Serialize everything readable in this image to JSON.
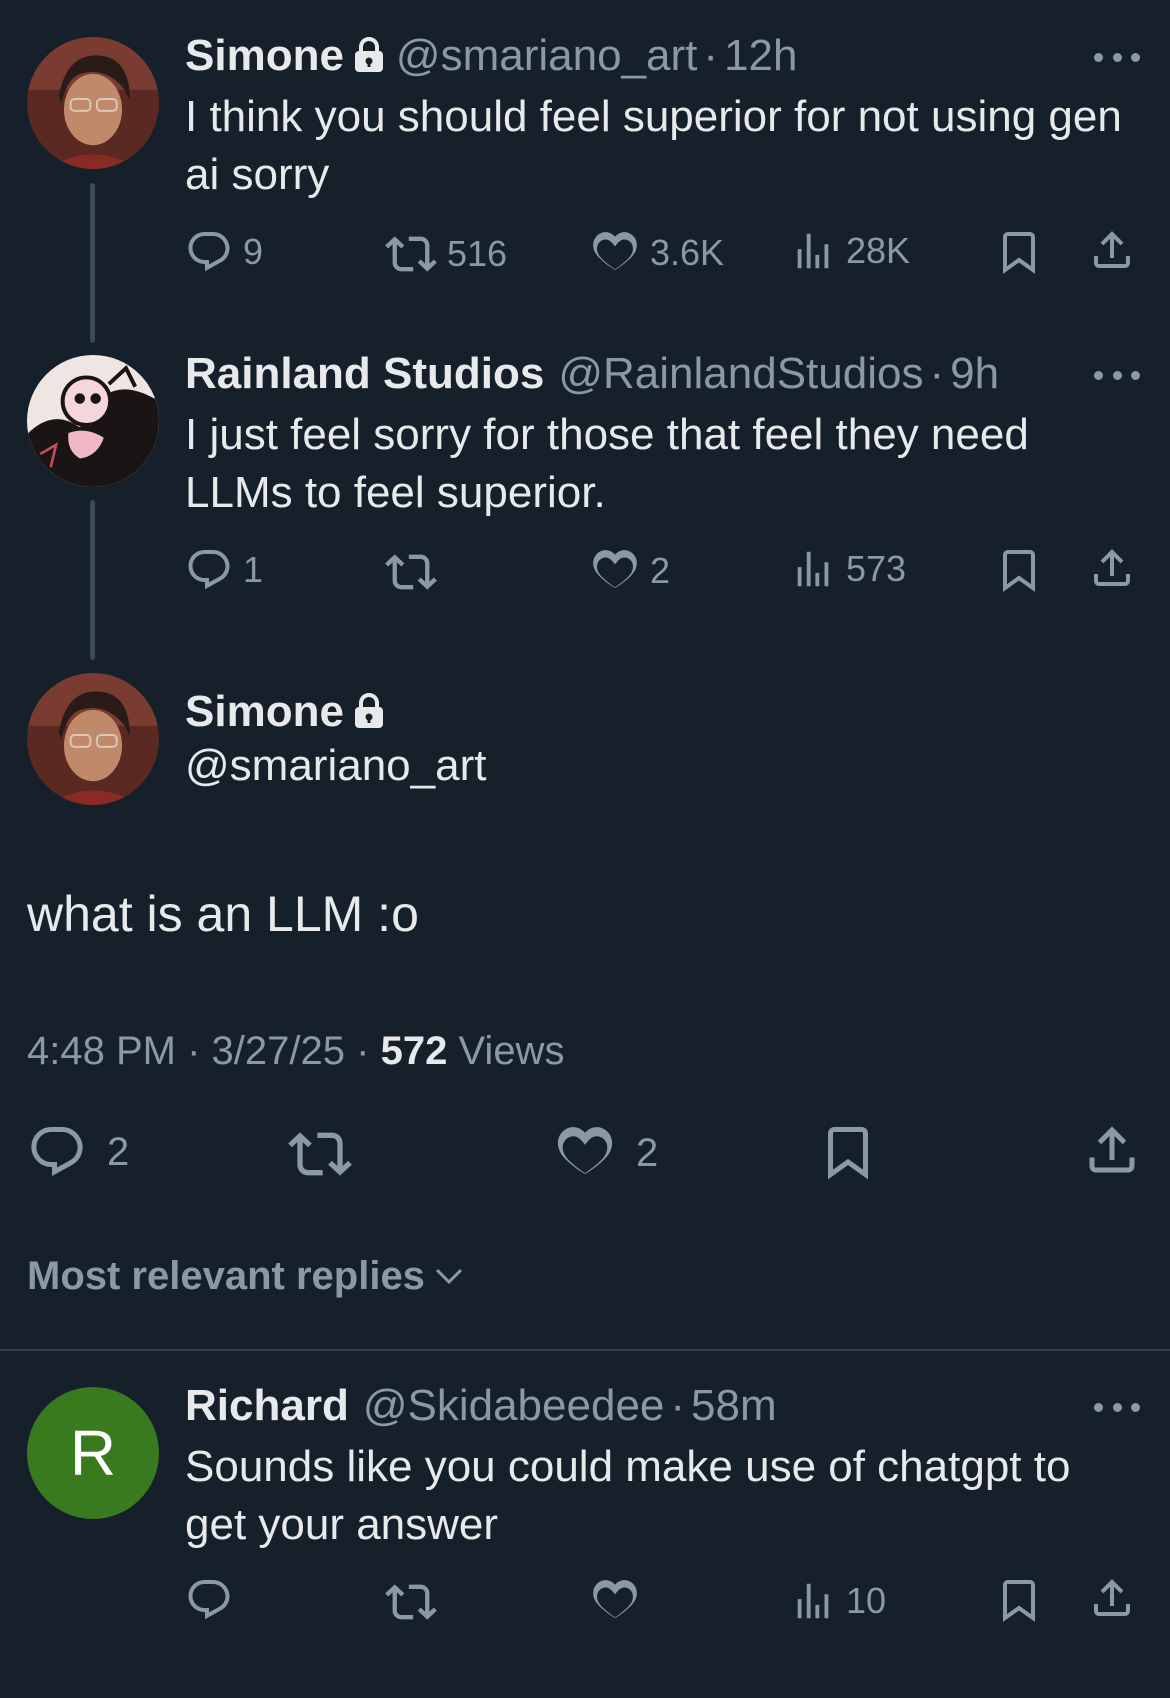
{
  "tweets": [
    {
      "name": "Simone",
      "handle": "@smariano_art",
      "time": "12h",
      "text": "I think you should feel superior for not using gen ai sorry",
      "replies": "9",
      "reposts": "516",
      "likes": "3.6K",
      "views": "28K"
    },
    {
      "name": "Rainland Studios",
      "handle": "@RainlandStudios",
      "time": "9h",
      "text": "I just feel sorry for those that feel they need LLMs to feel superior.",
      "replies": "1",
      "reposts": "",
      "likes": "2",
      "views": "573"
    }
  ],
  "main": {
    "name": "Simone",
    "handle": "@smariano_art",
    "text": "what is an LLM :o",
    "time": "4:48 PM",
    "date": "3/27/25",
    "views_count": "572",
    "views_label": "Views",
    "replies": "2",
    "likes": "2"
  },
  "replies_header": "Most relevant replies",
  "reply": {
    "avatar_letter": "R",
    "avatar_color": "#3a7a1e",
    "name": "Richard",
    "handle": "@Skidabeedee",
    "time": "58m",
    "text": "Sounds like you could make use of chatgpt to get your answer",
    "views": "10"
  },
  "separator": "·",
  "colors": {
    "background": "#15202b",
    "text": "#e7e9ea",
    "muted": "#8b98a5"
  },
  "icons": [
    "lock-icon",
    "more-icon",
    "reply-icon",
    "repost-icon",
    "like-icon",
    "views-icon",
    "bookmark-icon",
    "share-icon",
    "chevron-down-icon"
  ]
}
